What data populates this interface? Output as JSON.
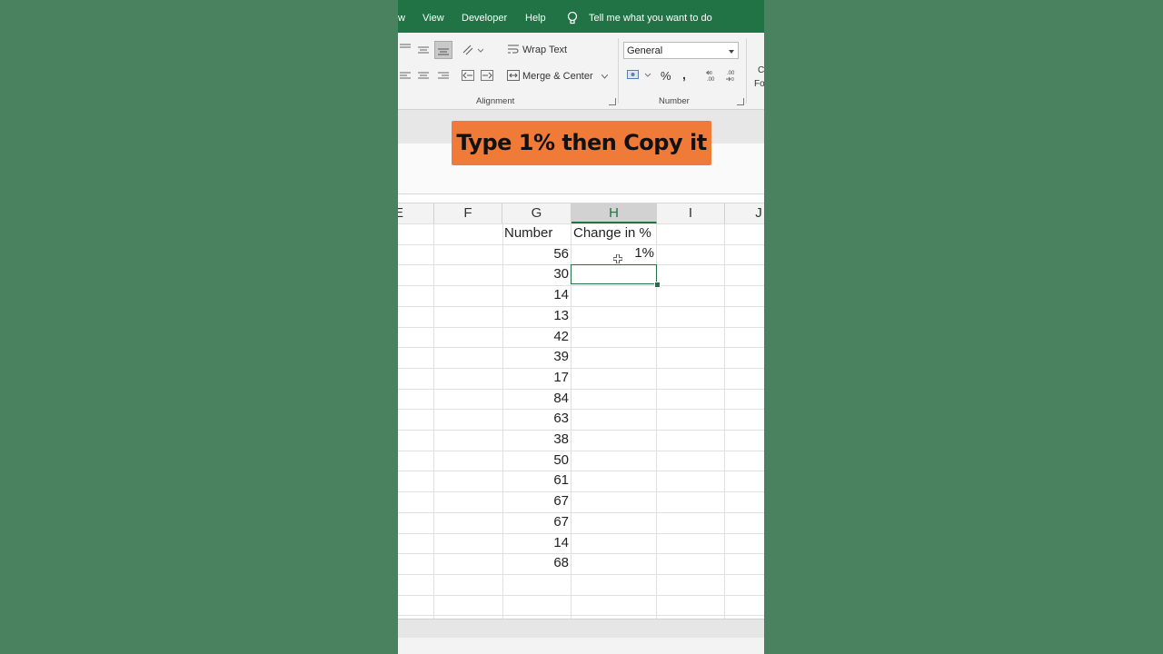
{
  "menu": {
    "items": [
      "w",
      "View",
      "Developer",
      "Help"
    ],
    "tell_me": "Tell me what you want to do",
    "bar_color": "#217346"
  },
  "ribbon": {
    "wrap_text": "Wrap Text",
    "merge_center": "Merge & Center",
    "alignment_label": "Alignment",
    "number_format": "General",
    "percent_symbol": "%",
    "comma_symbol": ",",
    "number_label": "Number",
    "partial_next": [
      "C",
      "Fo"
    ]
  },
  "overlay": {
    "caption": "Type 1% then Copy it",
    "color": "#f07a38"
  },
  "sheet": {
    "columns": [
      "E",
      "F",
      "G",
      "H",
      "I",
      "J"
    ],
    "active_column": "H",
    "header_number": "Number",
    "header_change": "Change in %",
    "numbers": [
      "56",
      "30",
      "14",
      "13",
      "42",
      "39",
      "17",
      "84",
      "63",
      "38",
      "50",
      "61",
      "67",
      "67",
      "14",
      "68"
    ],
    "change_first": "1%",
    "accent": "#217346"
  }
}
